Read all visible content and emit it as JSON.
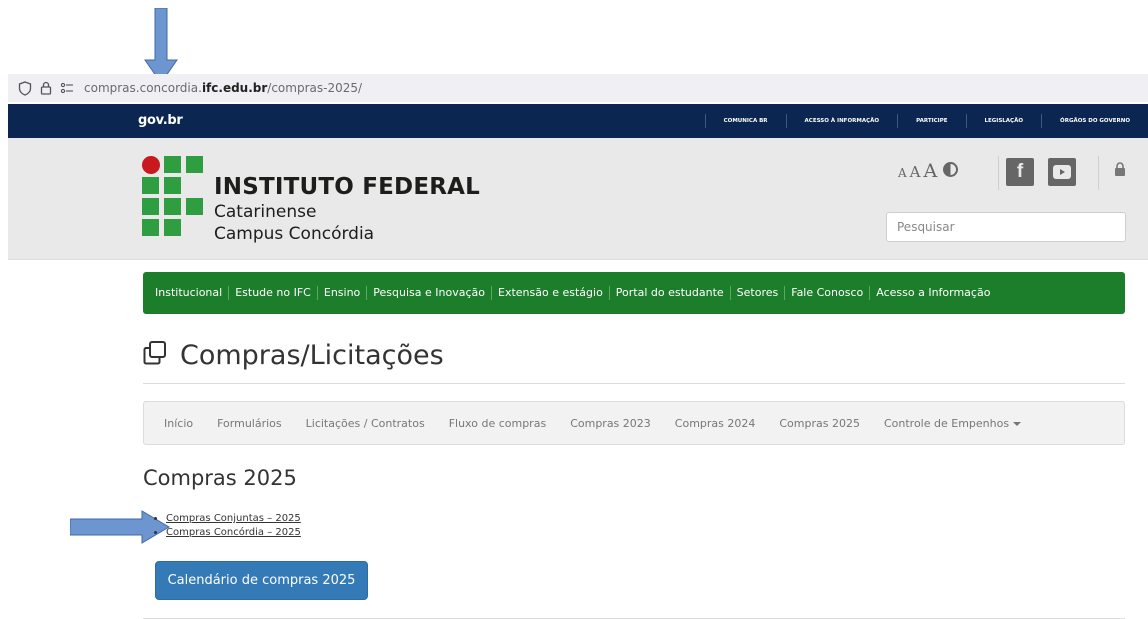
{
  "browser": {
    "url_prefix": "compras.concordia.",
    "url_domain": "ifc.edu.br",
    "url_path": "/compras-2025/",
    "icons": [
      "shield-icon",
      "lock-icon",
      "page-settings-icon"
    ]
  },
  "govbar": {
    "logo": "gov.br",
    "links": [
      "COMUNICA BR",
      "ACESSO À INFORMAÇÃO",
      "PARTICIPE",
      "LEGISLAÇÃO",
      "ÓRGÃOS DO GOVERNO"
    ],
    "color": "#0c2652"
  },
  "header": {
    "institution": "INSTITUTO FEDERAL",
    "line2": "Catarinense",
    "line3": "Campus Concórdia",
    "font_sizes": [
      "A",
      "A",
      "A"
    ],
    "search_placeholder": "Pesquisar",
    "social_icons": [
      "facebook-icon",
      "youtube-icon"
    ],
    "logo_colors": {
      "green": "#2f9e41",
      "red": "#c8191e"
    }
  },
  "mainnav": {
    "items": [
      "Institucional",
      "Estude no IFC",
      "Ensino",
      "Pesquisa e Inovação",
      "Extensão e estágio",
      "Portal do estudante",
      "Setores",
      "Fale Conosco",
      "Acesso a Informação"
    ],
    "color": "#1c7d2b"
  },
  "page": {
    "title": "Compras/Licitações",
    "title_icon": "copy-icon"
  },
  "subnav": {
    "items": [
      "Início",
      "Formulários",
      "Licitações / Contratos",
      "Fluxo de compras",
      "Compras 2023",
      "Compras 2024",
      "Compras 2025",
      "Controle de Empenhos"
    ]
  },
  "content": {
    "heading": "Compras 2025",
    "links": [
      "Compras Conjuntas – 2025",
      "Compras Concórdia – 2025"
    ],
    "button": "Calendário de compras 2025",
    "button_color": "#337ab7"
  },
  "annotations": {
    "arrow_color": "#6d95d0"
  }
}
